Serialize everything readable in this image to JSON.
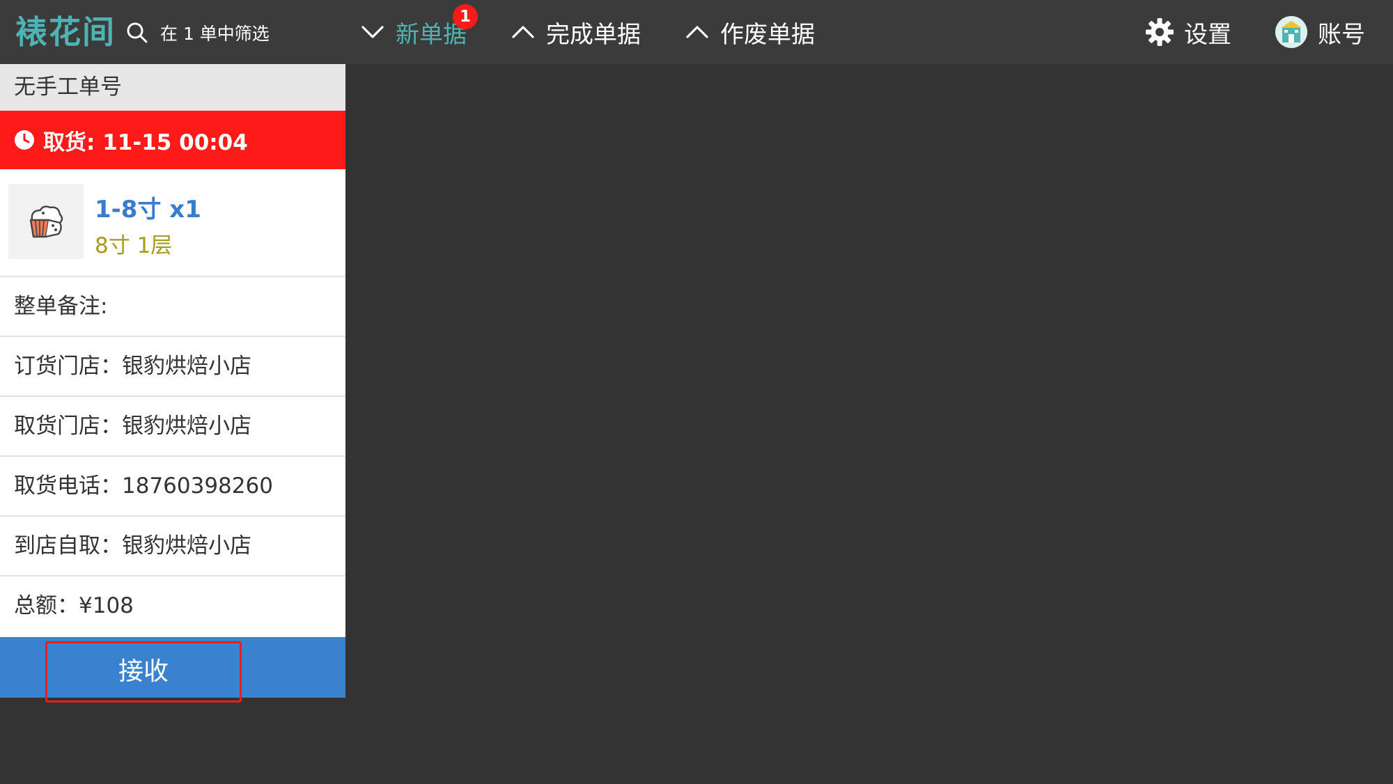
{
  "header": {
    "brand": "裱花间",
    "search_text": "在 1 单中筛选",
    "tabs": [
      {
        "label": "新单据",
        "badge": "1",
        "active": true
      },
      {
        "label": "完成单据"
      },
      {
        "label": "作废单据"
      }
    ],
    "settings_label": "设置",
    "account_label": "账号"
  },
  "order": {
    "manual_no": "无手工单号",
    "pickup_time": "取货: 11-15 00:04",
    "product_name": "1-8寸 x1",
    "product_spec": "8寸 1层",
    "remark": "整单备注:",
    "order_store": "订货门店：银豹烘焙小店",
    "pickup_store": "取货门店：银豹烘焙小店",
    "pickup_phone": "取货电话：18760398260",
    "self_pickup": "到店自取：银豹烘焙小店",
    "total": "总额：¥108",
    "accept_label": "接收"
  },
  "colors": {
    "brand": "#4db3b3",
    "alert": "#ff1a1a",
    "primary": "#3a82cf",
    "product_name": "#3a7ccc",
    "product_spec": "#a89a1c"
  }
}
